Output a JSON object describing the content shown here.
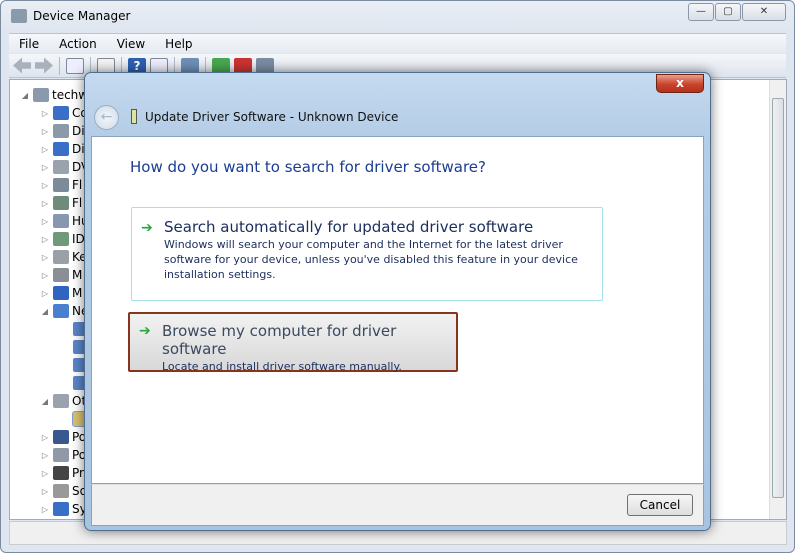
{
  "window": {
    "title": "Device Manager",
    "controls": [
      "minimize",
      "maximize",
      "close"
    ]
  },
  "menu": [
    "File",
    "Action",
    "View",
    "Help"
  ],
  "toolbar": [
    "back-icon",
    "forward-icon",
    "show-hide-console-tree-icon",
    "properties-icon",
    "help-icon",
    "action-pane-icon",
    "scan-hardware-icon",
    "update-driver-icon",
    "uninstall-icon",
    "disable-icon"
  ],
  "tree": [
    {
      "label": "techw",
      "level": 0,
      "expanded": true
    },
    {
      "label": "Co",
      "level": 1
    },
    {
      "label": "Di",
      "level": 1
    },
    {
      "label": "Di",
      "level": 1
    },
    {
      "label": "DV",
      "level": 1
    },
    {
      "label": "Fl",
      "level": 1
    },
    {
      "label": "Fl",
      "level": 1
    },
    {
      "label": "Hu",
      "level": 1
    },
    {
      "label": "ID",
      "level": 1
    },
    {
      "label": "Ke",
      "level": 1
    },
    {
      "label": "M",
      "level": 1
    },
    {
      "label": "M",
      "level": 1
    },
    {
      "label": "Ne",
      "level": 1,
      "expanded": true
    },
    {
      "label": "",
      "level": 2
    },
    {
      "label": "",
      "level": 2
    },
    {
      "label": "",
      "level": 2
    },
    {
      "label": "",
      "level": 2
    },
    {
      "label": "Ot",
      "level": 1,
      "expanded": true
    },
    {
      "label": "",
      "level": 2,
      "selected": true
    },
    {
      "label": "Po",
      "level": 1
    },
    {
      "label": "Po",
      "level": 1
    },
    {
      "label": "Pr",
      "level": 1
    },
    {
      "label": "So",
      "level": 1
    },
    {
      "label": "Sy",
      "level": 1
    }
  ],
  "dialog": {
    "title": "Update Driver Software - Unknown Device",
    "close_label": "x",
    "question": "How do you want to search for driver software?",
    "options": [
      {
        "heading": "Search automatically for updated driver software",
        "description": "Windows will search your computer and the Internet for the latest driver software for your device, unless you've disabled this feature in your device installation settings."
      },
      {
        "heading": "Browse my computer for driver software",
        "description": "Locate and install driver software manually.",
        "highlighted": true
      }
    ],
    "cancel_label": "Cancel"
  },
  "colors": {
    "question": "#1b3d91",
    "arrow": "#22a83a",
    "highlight_border": "#87341f",
    "close": "#c9432c"
  }
}
